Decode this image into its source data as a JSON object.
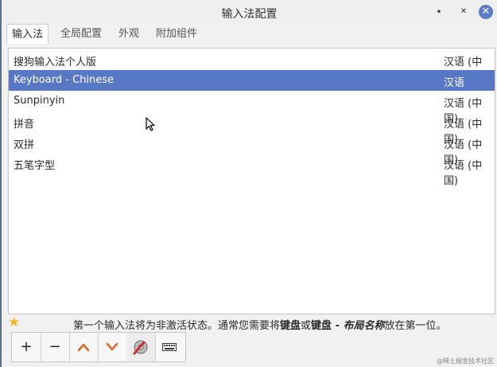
{
  "window": {
    "title": "输入法配置",
    "controls": {
      "minimize": "•",
      "maximize": "✕",
      "close": "✕"
    }
  },
  "tabs": [
    {
      "label": "输入法",
      "active": true
    },
    {
      "label": "全局配置",
      "active": false
    },
    {
      "label": "外观",
      "active": false
    },
    {
      "label": "附加组件",
      "active": false
    }
  ],
  "input_methods": [
    {
      "name": "搜狗输入法个人版",
      "language": "汉语 (中国)",
      "selected": false
    },
    {
      "name": "Keyboard - Chinese",
      "language": "汉语",
      "selected": true
    },
    {
      "name": "Sunpinyin",
      "language": "汉语 (中国)",
      "selected": false
    },
    {
      "name": "拼音",
      "language": "汉语 (中国)",
      "selected": false
    },
    {
      "name": "双拼",
      "language": "汉语 (中国)",
      "selected": false
    },
    {
      "name": "五笔字型",
      "language": "汉语 (中国)",
      "selected": false
    }
  ],
  "info": {
    "part1": "第一个输入法将为非激活状态。通常您需要将",
    "bold1": "键盘",
    "part2": "或",
    "bold2": "键盘 - ",
    "italic_bold": "布局名称",
    "part3": "放在第一位。"
  },
  "toolbar": {
    "add": "+",
    "remove": "−",
    "up": "︿",
    "down": "﹀",
    "configure_icon": "settings-tools-icon",
    "keyboard_icon": "keyboard-icon"
  },
  "watermark": "@稀土掘金技术社区",
  "colors": {
    "selection": "#5877c4",
    "close_button": "#5a7dc6",
    "arrow": "#e06a28"
  }
}
